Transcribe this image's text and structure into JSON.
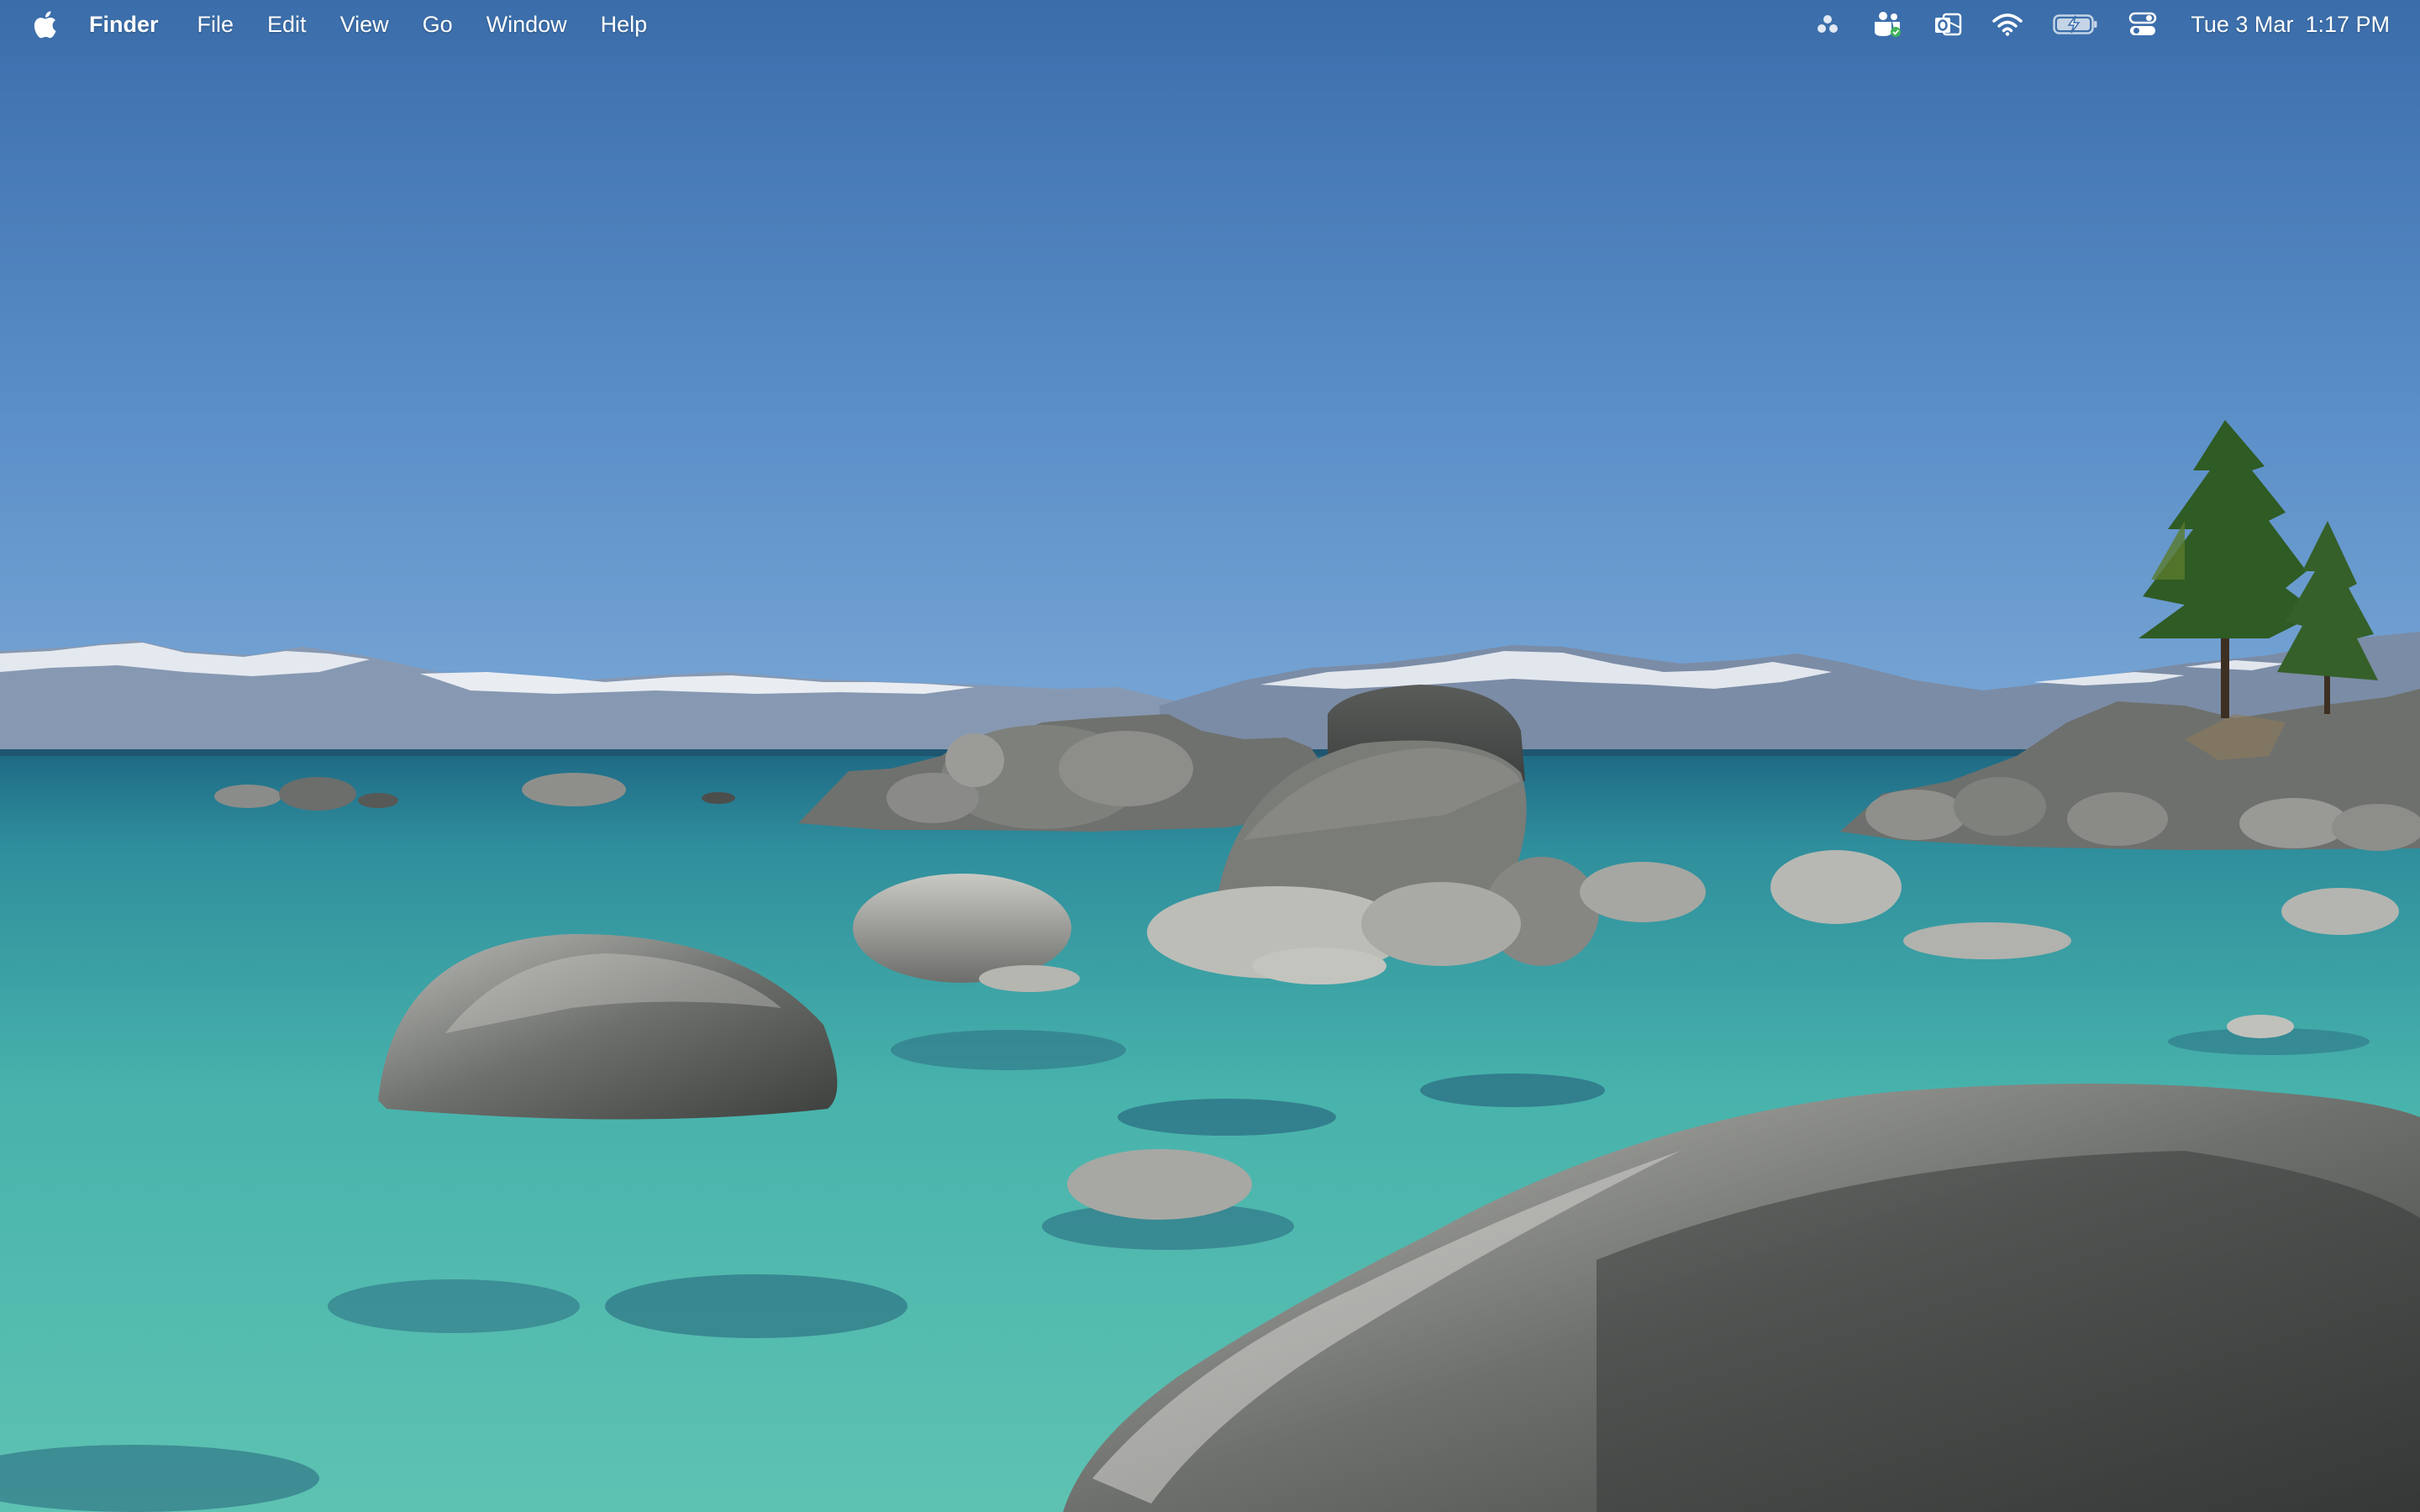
{
  "menubar": {
    "apple_icon": "apple-logo-icon",
    "app_name": "Finder",
    "menus": [
      "File",
      "Edit",
      "View",
      "Go",
      "Window",
      "Help"
    ],
    "status_icons": [
      "siri-dots-icon",
      "teams-icon",
      "outlook-icon",
      "wifi-icon",
      "battery-charging-icon",
      "control-center-icon"
    ],
    "clock": {
      "date": "Tue 3 Mar",
      "time": "1:17 PM"
    }
  },
  "wallpaper": {
    "description_colors": {
      "sky_top": "#3c70ae",
      "sky_bottom": "#6ea0d3",
      "water_deep": "#2f6f7c",
      "water_shallow": "#4fbcb5",
      "rock": "#8d8d8a",
      "snow": "#e9eef3"
    }
  }
}
